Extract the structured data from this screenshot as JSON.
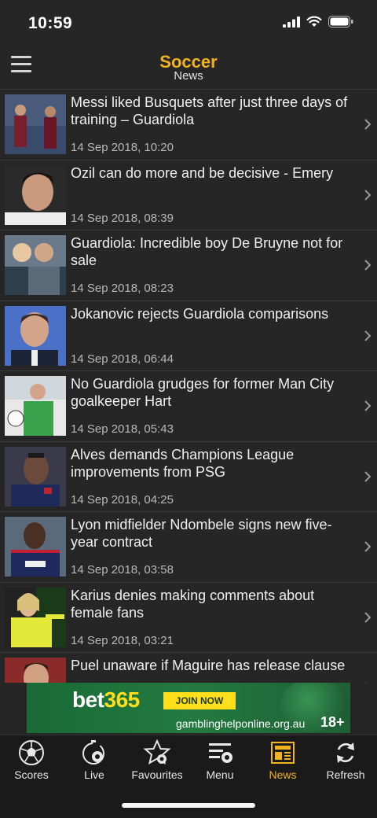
{
  "status_bar": {
    "time": "10:59"
  },
  "header": {
    "title": "Soccer",
    "subtitle": "News"
  },
  "news": [
    {
      "headline": "Messi liked Busquets after just three days of training – Guardiola",
      "date": "14 Sep 2018, 10:20"
    },
    {
      "headline": "Ozil can do more and be decisive - Emery",
      "date": "14 Sep 2018, 08:39"
    },
    {
      "headline": "Guardiola: Incredible boy De Bruyne not for sale",
      "date": "14 Sep 2018, 08:23"
    },
    {
      "headline": "Jokanovic rejects Guardiola comparisons",
      "date": "14 Sep 2018, 06:44"
    },
    {
      "headline": "No Guardiola grudges for former Man City goalkeeper Hart",
      "date": "14 Sep 2018, 05:43"
    },
    {
      "headline": "Alves demands Champions League improvements from PSG",
      "date": "14 Sep 2018, 04:25"
    },
    {
      "headline": "Lyon midfielder Ndombele signs new five-year contract",
      "date": "14 Sep 2018, 03:58"
    },
    {
      "headline": "Karius denies making comments about female fans",
      "date": "14 Sep 2018, 03:21"
    },
    {
      "headline": "Puel unaware if Maguire has release clause",
      "date": ""
    }
  ],
  "ad": {
    "brand_main": "bet",
    "brand_accent": "365",
    "cta": "JOIN NOW",
    "disclaimer": "gamblinghelponline.org.au",
    "age": "18+"
  },
  "tabs": [
    {
      "label": "Scores",
      "icon": "soccer-ball-icon"
    },
    {
      "label": "Live",
      "icon": "live-stopwatch-icon"
    },
    {
      "label": "Favourites",
      "icon": "star-ball-icon"
    },
    {
      "label": "Menu",
      "icon": "menu-ball-icon"
    },
    {
      "label": "News",
      "icon": "newspaper-icon"
    },
    {
      "label": "Refresh",
      "icon": "refresh-icon"
    }
  ],
  "active_tab": "News",
  "colors": {
    "accent": "#f3b320",
    "background": "#262626",
    "tab_bar": "#1a1a1a"
  }
}
